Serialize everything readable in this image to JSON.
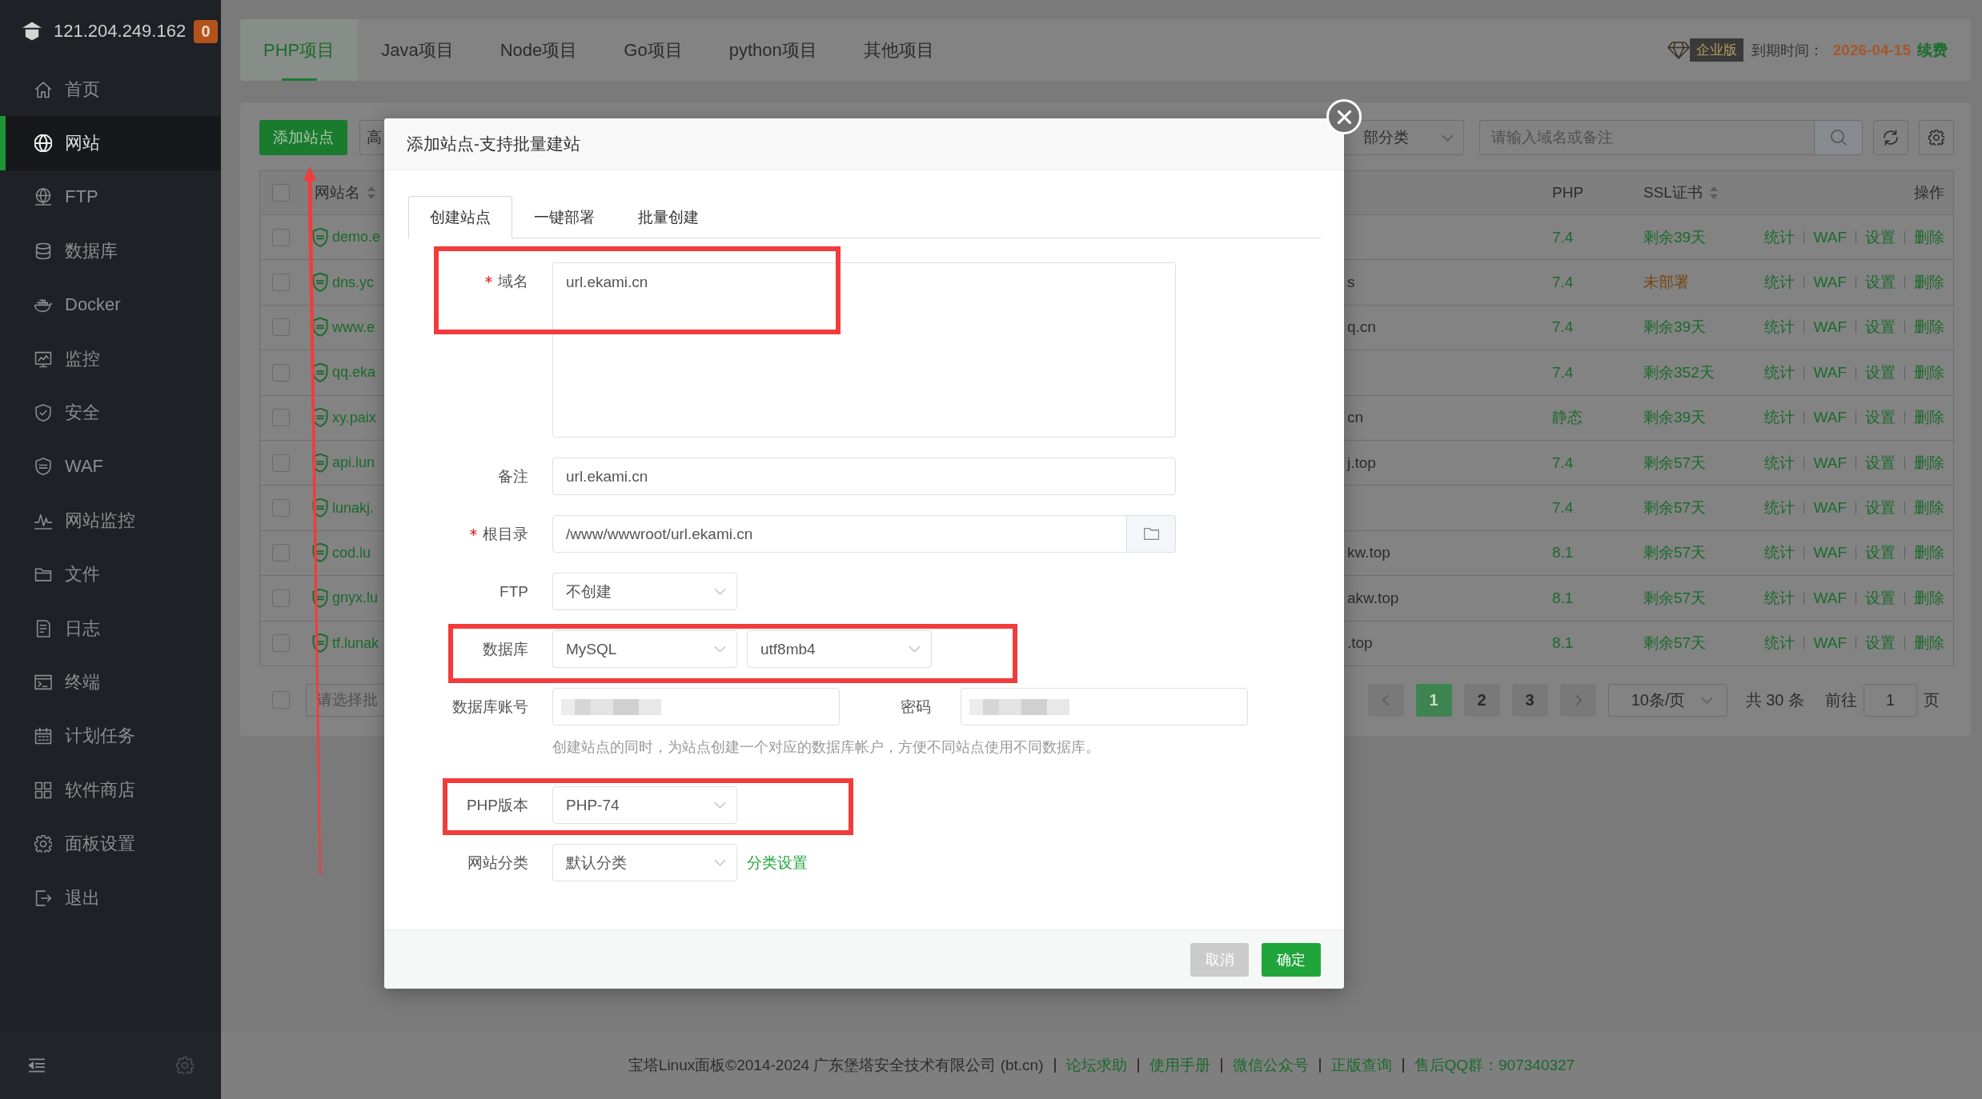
{
  "sidebar": {
    "host": "121.204.249.162",
    "alert_count": "0",
    "items": [
      {
        "label": "首页",
        "selected": false
      },
      {
        "label": "网站",
        "selected": true
      },
      {
        "label": "FTP",
        "selected": false
      },
      {
        "label": "数据库",
        "selected": false
      },
      {
        "label": "Docker",
        "selected": false
      },
      {
        "label": "监控",
        "selected": false
      },
      {
        "label": "安全",
        "selected": false
      },
      {
        "label": "WAF",
        "selected": false
      },
      {
        "label": "网站监控",
        "selected": false
      },
      {
        "label": "文件",
        "selected": false
      },
      {
        "label": "日志",
        "selected": false
      },
      {
        "label": "终端",
        "selected": false
      },
      {
        "label": "计划任务",
        "selected": false
      },
      {
        "label": "软件商店",
        "selected": false
      },
      {
        "label": "面板设置",
        "selected": false
      },
      {
        "label": "退出",
        "selected": false
      }
    ]
  },
  "project_tabs": [
    {
      "label": "PHP项目",
      "selected": true
    },
    {
      "label": "Java项目",
      "selected": false
    },
    {
      "label": "Node项目",
      "selected": false
    },
    {
      "label": "Go项目",
      "selected": false
    },
    {
      "label": "python项目",
      "selected": false
    },
    {
      "label": "其他项目",
      "selected": false
    }
  ],
  "license": {
    "edition": "企业版",
    "expiry_label": "到期时间：",
    "expiry_date": "2026-04-15",
    "renew": "续费"
  },
  "toolbar": {
    "add_button": {
      "label": "添加站点",
      "arrow_marked": true
    },
    "partial_button": "高",
    "category_select": "部分类",
    "search": {
      "placeholder": "请输入域名或备注"
    }
  },
  "table": {
    "header_checked": false,
    "columns": [
      {
        "label": "网站名",
        "sortable": true
      },
      {
        "label": "PHP",
        "sortable": false
      },
      {
        "label": "SSL证书",
        "sortable": true
      },
      {
        "label": "操作",
        "sortable": false
      }
    ],
    "rows": [
      {
        "checked": false,
        "name": "demo.e",
        "php": "7.4",
        "ssl": "剩余39天",
        "ssl_deployed": true,
        "actions": [
          "统计",
          "WAF",
          "设置",
          "删除"
        ]
      },
      {
        "checked": false,
        "name": "dns.yc",
        "column_3": "s",
        "php": "7.4",
        "ssl": "未部署",
        "ssl_deployed": false,
        "actions": [
          "统计",
          "WAF",
          "设置",
          "删除"
        ]
      },
      {
        "checked": false,
        "name": "www.e",
        "column_3": "q.cn",
        "php": "7.4",
        "ssl": "剩余39天",
        "ssl_deployed": true,
        "actions": [
          "统计",
          "WAF",
          "设置",
          "删除"
        ]
      },
      {
        "checked": false,
        "name": "qq.eka",
        "php": "7.4",
        "ssl": "剩余352天",
        "ssl_deployed": true,
        "actions": [
          "统计",
          "WAF",
          "设置",
          "删除"
        ]
      },
      {
        "checked": false,
        "name": "xy.paix",
        "column_3": "cn",
        "php": "静态",
        "ssl": "剩余39天",
        "ssl_deployed": true,
        "actions": [
          "统计",
          "WAF",
          "设置",
          "删除"
        ]
      },
      {
        "checked": false,
        "name": "api.lun",
        "column_3": "j.top",
        "php": "7.4",
        "ssl": "剩余57天",
        "ssl_deployed": true,
        "actions": [
          "统计",
          "WAF",
          "设置",
          "删除"
        ]
      },
      {
        "checked": false,
        "name": "lunakj.",
        "php": "7.4",
        "ssl": "剩余57天",
        "ssl_deployed": true,
        "actions": [
          "统计",
          "WAF",
          "设置",
          "删除"
        ]
      },
      {
        "checked": false,
        "name": "cod.lu",
        "column_3": "kw.top",
        "php": "8.1",
        "ssl": "剩余57天",
        "ssl_deployed": true,
        "actions": [
          "统计",
          "WAF",
          "设置",
          "删除"
        ]
      },
      {
        "checked": false,
        "name": "gnyx.lu",
        "column_3": "akw.top",
        "php": "8.1",
        "ssl": "剩余57天",
        "ssl_deployed": true,
        "actions": [
          "统计",
          "WAF",
          "设置",
          "删除"
        ]
      },
      {
        "checked": false,
        "name": "tf.lunak",
        "column_3": ".top",
        "php": "8.1",
        "ssl": "剩余57天",
        "ssl_deployed": true,
        "actions": [
          "统计",
          "WAF",
          "设置",
          "删除"
        ]
      }
    ]
  },
  "pagination": {
    "checked": false,
    "batch_select": {
      "placeholder": "请选择批"
    },
    "pages": [
      {
        "label": "1",
        "selected": true
      },
      {
        "label": "2",
        "selected": false
      },
      {
        "label": "3",
        "selected": false
      }
    ],
    "page_size": "10条/页",
    "total": "共 30 条",
    "goto_label": "前往",
    "goto_value": "1",
    "goto_suffix": "页"
  },
  "modal": {
    "title": "添加站点-支持批量建站",
    "tabs": [
      {
        "label": "创建站点",
        "selected": true
      },
      {
        "label": "一键部署",
        "selected": false
      },
      {
        "label": "批量创建",
        "selected": false
      }
    ],
    "fields": [
      {
        "kind": "textarea",
        "label": "域名",
        "required": true,
        "value": "url.ekami.cn",
        "highlighted": true
      },
      {
        "kind": "input",
        "label": "备注",
        "required": false,
        "value": "url.ekami.cn",
        "highlighted": false
      },
      {
        "kind": "path",
        "label": "根目录",
        "required": true,
        "value": "/www/wwwroot/url.ekami.cn",
        "highlighted": false
      },
      {
        "kind": "select",
        "label": "FTP",
        "required": false,
        "value": "不创建",
        "highlighted": false
      },
      {
        "kind": "select_pair",
        "label": "数据库",
        "required": false,
        "values": [
          "MySQL",
          "utf8mb4"
        ],
        "highlighted": true
      },
      {
        "kind": "credentials",
        "label": "数据库账号",
        "required": false,
        "redacted": true,
        "password_label": "密码",
        "password_redacted": true,
        "highlighted": false
      },
      {
        "kind": "hint",
        "text": "创建站点的同时，为站点创建一个对应的数据库帐户，方便不同站点使用不同数据库。"
      },
      {
        "kind": "select",
        "label": "PHP版本",
        "required": false,
        "value": "PHP-74",
        "highlighted": true
      },
      {
        "kind": "select_link",
        "label": "网站分类",
        "required": false,
        "value": "默认分类",
        "link": "分类设置",
        "highlighted": false
      }
    ],
    "buttons": [
      {
        "label": "取消",
        "kind": "cancel"
      },
      {
        "label": "确定",
        "kind": "primary"
      }
    ]
  },
  "footer": {
    "copyright": "宝塔Linux面板©2014-2024 广东堡塔安全技术有限公司 (bt.cn)",
    "links": [
      "论坛求助",
      "使用手册",
      "微信公众号",
      "正版查询",
      "售后QQ群：907340327"
    ]
  }
}
